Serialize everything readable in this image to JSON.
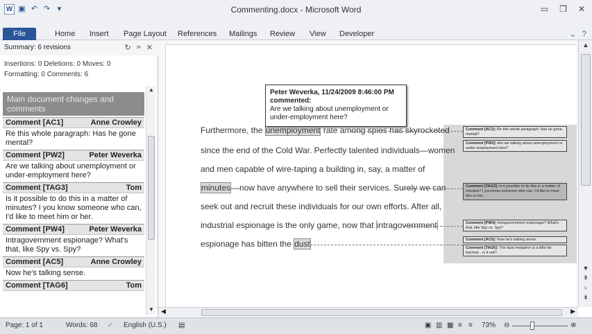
{
  "window": {
    "title": "Commenting.docx - Microsoft Word",
    "qat_icons": [
      "word-icon",
      "save-icon",
      "undo-icon",
      "redo-icon",
      "customize-icon"
    ],
    "controls": [
      "minimize-icon",
      "restore-icon",
      "close-icon"
    ]
  },
  "ribbon": {
    "file_tab": "File",
    "tabs": [
      "Home",
      "Insert",
      "Page Layout",
      "References",
      "Mailings",
      "Review",
      "View",
      "Developer"
    ]
  },
  "reviewing_pane": {
    "summary": "Summary: 6 revisions",
    "counts_line1": "Insertions: 0  Deletions: 0  Moves: 0",
    "counts_line2": "Formatting: 0  Comments: 6",
    "section_title": "Main document changes and comments",
    "comments": [
      {
        "id": "Comment [AC1]",
        "author": "Anne Crowley",
        "text": "Re this whole paragraph: Has he gone mental?"
      },
      {
        "id": "Comment [PW2]",
        "author": "Peter Weverka",
        "text": "Are we talking about unemployment or under-employment here?"
      },
      {
        "id": "Comment [TAG3]",
        "author": "Tom",
        "text": "Is it possible to do this in a matter of minutes? I you know someone who can, I'd like to meet him or her."
      },
      {
        "id": "Comment [PW4]",
        "author": "Peter Weverka",
        "text": "Intragovernment espionage? What's that, like Spy vs. Spy?"
      },
      {
        "id": "Comment [AC5]",
        "author": "Anne Crowley",
        "text": "Now he's talking sense."
      },
      {
        "id": "Comment [TAG6]",
        "author": "Tom",
        "text": ""
      }
    ]
  },
  "document": {
    "l1_pre": "Furthermore, the ",
    "l1_hl": "unemployment",
    "l1_post": " rate among spies has skyrocketed",
    "l2": "since the end of the Cold War. Perfectly talented individuals—women",
    "l3": "and men capable of wire-taping a building in, say, a matter of",
    "l4_hl": "minutes",
    "l4_post": "—now have anywhere to sell their services. Surely we can",
    "l5": "seek out and recruit these individuals for our own efforts. After all,",
    "l6_pre": "industrial espionage is the only game, now that ",
    "l6_hl": "intragovernment",
    "l7_pre": "espionage has bitten the ",
    "l7_hl": "dust",
    "tooltip": {
      "author_line": "Peter Weverka, 11/24/2009 8:46:00 PM",
      "action": "commented:",
      "text": "Are we talking about unemployment or under-employment here?"
    },
    "balloons": [
      {
        "label": "Comment [AC1]:",
        "text": "Re this whole paragraph: Has he gone mental?"
      },
      {
        "label": "Comment [PW2]:",
        "text": "Are we talking about unemployment or under-employment here?"
      },
      {
        "label": "Comment [TAG3]:",
        "text": "Is it possible to do this in a matter of minutes? I you know someone who can, I'd like to meet him or her."
      },
      {
        "label": "Comment [PW4]:",
        "text": "Intragovernment espionage? What's that, like Spy vs. Spy?"
      },
      {
        "label": "Comment [AC5]:",
        "text": "Now he's talking sense."
      },
      {
        "label": "Comment [TAG6]:",
        "text": "The dust metaphor is a little far fetched... is it not?"
      }
    ]
  },
  "status": {
    "page": "Page: 1 of 1",
    "words": "Words: 68",
    "language": "English (U.S.)",
    "zoom": "73%"
  }
}
